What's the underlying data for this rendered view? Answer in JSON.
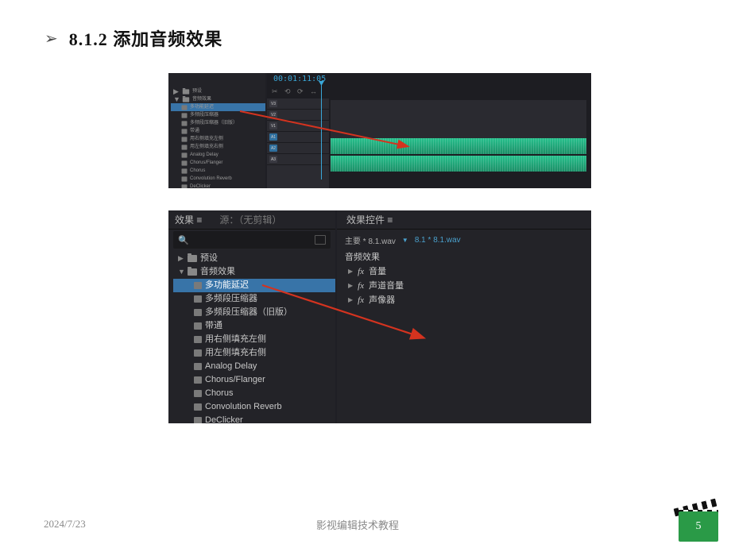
{
  "heading": {
    "bullet": "➢",
    "text": "8.1.2 添加音频效果"
  },
  "figure1": {
    "timecode": "00:01:11:05",
    "fx_list": [
      "预设",
      "音频效果",
      "多功能延迟",
      "多频段压缩器",
      "多频段压缩器（旧版）",
      "带通",
      "用右侧填充左侧",
      "用左侧填充右侧",
      "Analog Delay",
      "Chorus/Flanger",
      "Chorus",
      "Convolution Reverb",
      "DeClicker"
    ],
    "tracks": {
      "v": [
        "V3",
        "V2",
        "V1"
      ],
      "a": [
        "A1",
        "A2",
        "A3"
      ]
    }
  },
  "figure2": {
    "fx_panel": {
      "tab1": "效果  ≡",
      "tab2": "源：（无剪辑）",
      "items": [
        {
          "type": "folder",
          "label": "预设",
          "caret": "▶"
        },
        {
          "type": "folder",
          "label": "音频效果",
          "caret": "▼"
        },
        {
          "type": "preset",
          "label": "多功能延迟",
          "sel": true
        },
        {
          "type": "preset",
          "label": "多频段压缩器"
        },
        {
          "type": "preset",
          "label": "多频段压缩器（旧版）"
        },
        {
          "type": "preset",
          "label": "带通"
        },
        {
          "type": "preset",
          "label": "用右侧填充左侧"
        },
        {
          "type": "preset",
          "label": "用左侧填充右侧"
        },
        {
          "type": "preset",
          "label": "Analog Delay"
        },
        {
          "type": "preset",
          "label": "Chorus/Flanger"
        },
        {
          "type": "preset",
          "label": "Chorus"
        },
        {
          "type": "preset",
          "label": "Convolution Reverb"
        },
        {
          "type": "preset",
          "label": "DeClicker"
        }
      ]
    },
    "ctrl_panel": {
      "tab": "效果控件  ≡",
      "master_label": "主要 * 8.1.wav",
      "master_link": "8.1 * 8.1.wav",
      "section": "音频效果",
      "rows": [
        "音量",
        "声道音量",
        "声像器"
      ]
    }
  },
  "footer": {
    "date": "2024/7/23",
    "title": "影视编辑技术教程",
    "page_gray": "5",
    "page_badge": "5"
  }
}
